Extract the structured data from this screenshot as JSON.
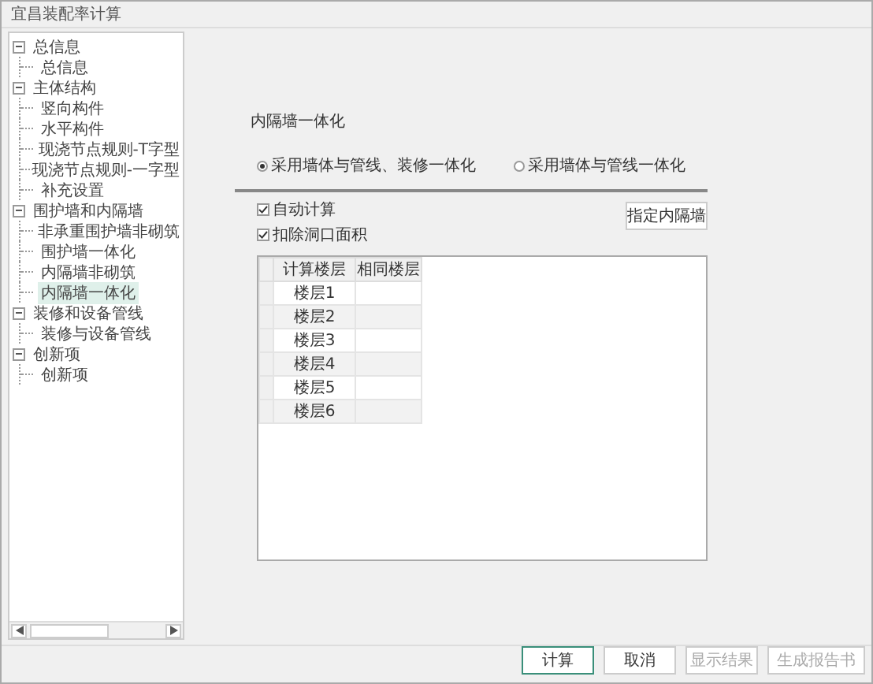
{
  "window": {
    "title": "宜昌装配率计算"
  },
  "tree": [
    {
      "label": "总信息",
      "expanded": true,
      "selected": false,
      "children": [
        {
          "label": "总信息",
          "selected": false
        }
      ]
    },
    {
      "label": "主体结构",
      "expanded": true,
      "selected": false,
      "children": [
        {
          "label": "竖向构件",
          "selected": false
        },
        {
          "label": "水平构件",
          "selected": false
        },
        {
          "label": "现浇节点规则-T字型",
          "selected": false
        },
        {
          "label": "现浇节点规则-一字型",
          "selected": false
        },
        {
          "label": "补充设置",
          "selected": false
        }
      ]
    },
    {
      "label": "围护墙和内隔墙",
      "expanded": true,
      "selected": false,
      "children": [
        {
          "label": "非承重围护墙非砌筑",
          "selected": false
        },
        {
          "label": "围护墙一体化",
          "selected": false
        },
        {
          "label": "内隔墙非砌筑",
          "selected": false
        },
        {
          "label": "内隔墙一体化",
          "selected": true
        }
      ]
    },
    {
      "label": "装修和设备管线",
      "expanded": true,
      "selected": false,
      "children": [
        {
          "label": "装修与设备管线",
          "selected": false
        }
      ]
    },
    {
      "label": "创新项",
      "expanded": true,
      "selected": false,
      "children": [
        {
          "label": "创新项",
          "selected": false
        }
      ]
    }
  ],
  "section_title": "内隔墙一体化",
  "radios": [
    {
      "label": "采用墙体与管线、装修一体化",
      "selected": true
    },
    {
      "label": "采用墙体与管线一体化",
      "selected": false
    }
  ],
  "checkboxes": [
    {
      "label": "自动计算",
      "checked": true
    },
    {
      "label": "扣除洞口面积",
      "checked": true
    }
  ],
  "assign_button": "指定内隔墙",
  "table": {
    "columns": [
      "计算楼层",
      "相同楼层"
    ],
    "rows": [
      [
        "楼层1",
        ""
      ],
      [
        "楼层2",
        ""
      ],
      [
        "楼层3",
        ""
      ],
      [
        "楼层4",
        ""
      ],
      [
        "楼层5",
        ""
      ],
      [
        "楼层6",
        ""
      ]
    ]
  },
  "buttons": [
    {
      "label": "计算",
      "default": true,
      "disabled": false
    },
    {
      "label": "取消",
      "default": false,
      "disabled": false
    },
    {
      "label": "显示结果",
      "default": false,
      "disabled": true
    },
    {
      "label": "生成报告书",
      "default": false,
      "disabled": true
    }
  ]
}
